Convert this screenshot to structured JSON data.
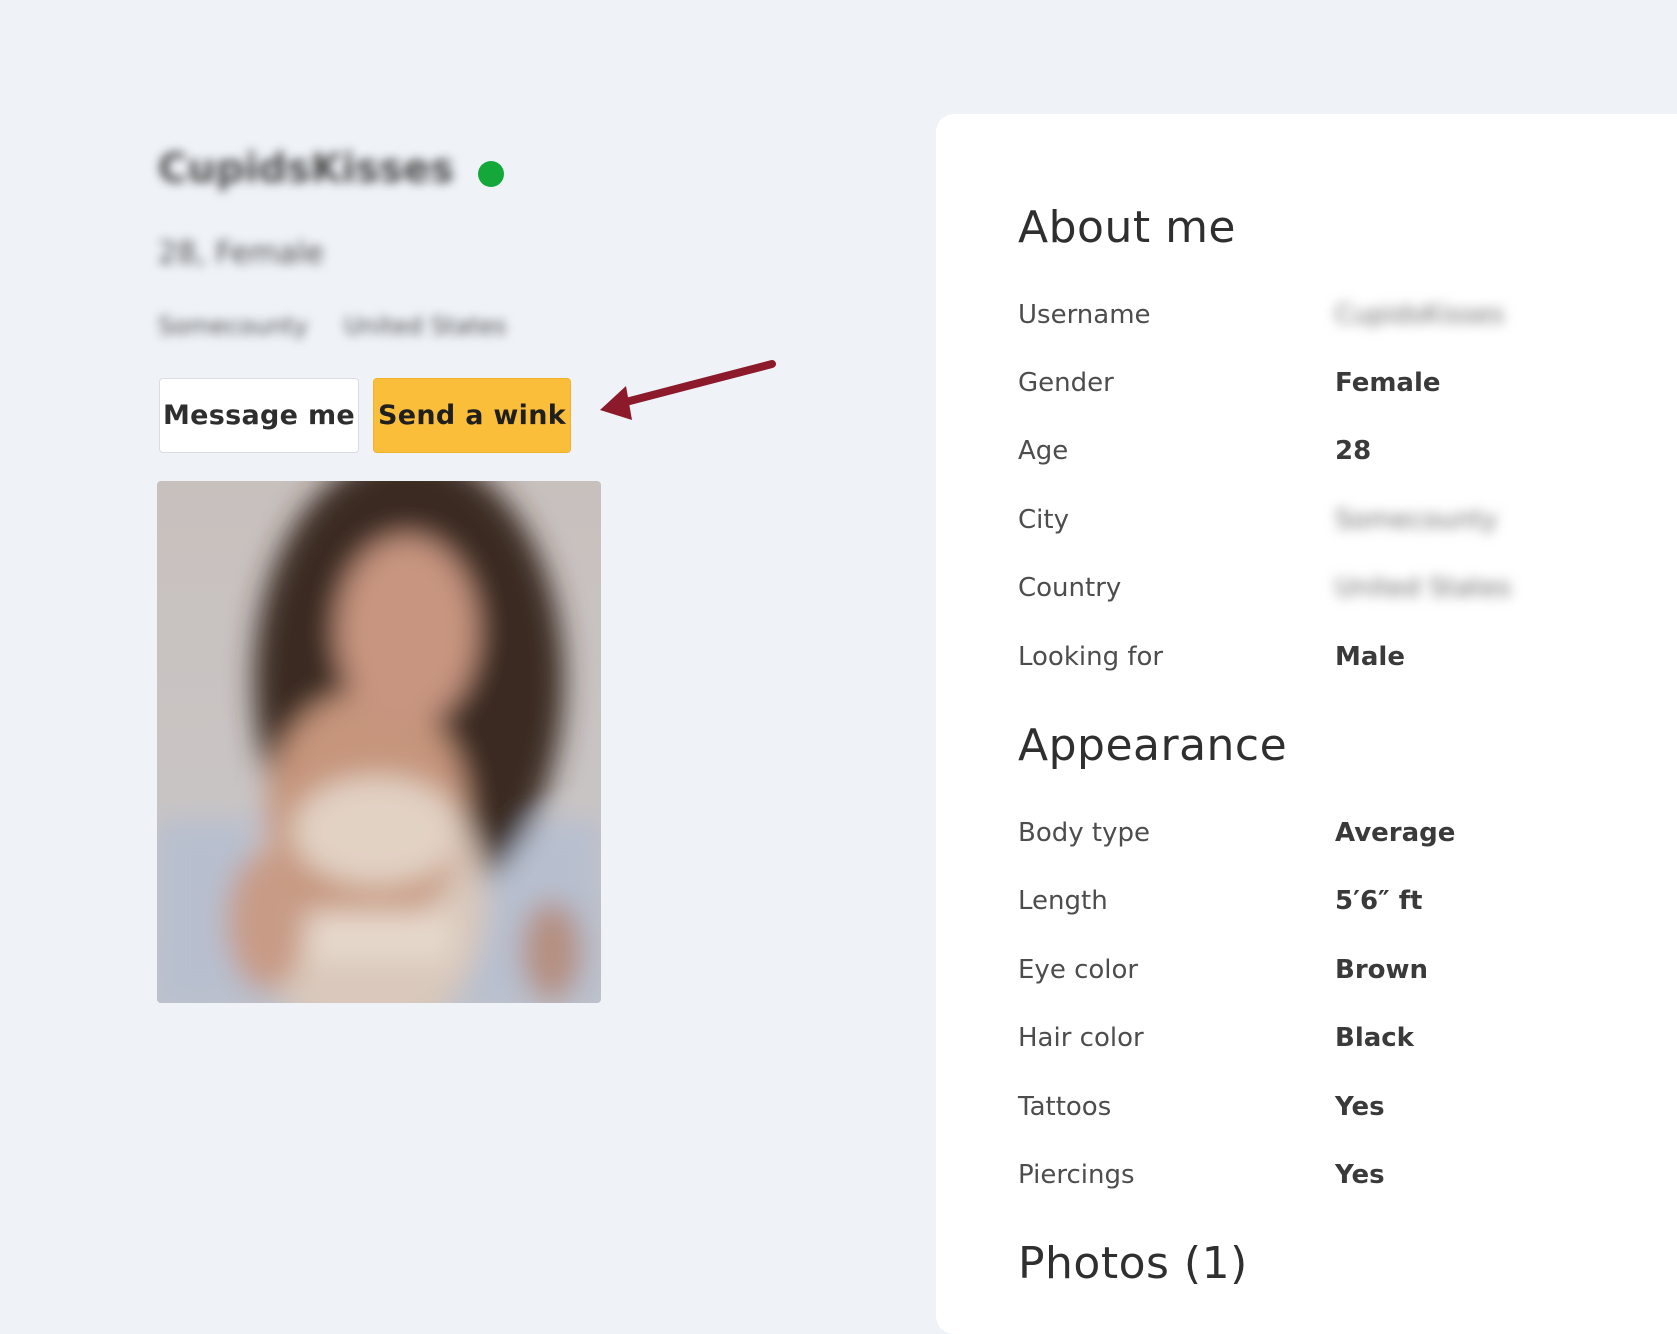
{
  "profile": {
    "username": "CupidsKisses",
    "age_gender": "28, Female",
    "city": "Somecounty",
    "country": "United States",
    "online_status_color": "#14a83b"
  },
  "actions": {
    "message_label": "Message me",
    "wink_label": "Send a wink",
    "wink_color": "#fbbe3b"
  },
  "annotation": {
    "arrow_color": "#8d1a2a",
    "icon": "arrow-left-icon"
  },
  "photo": {
    "icon": "profile-photo"
  },
  "about": {
    "heading": "About me",
    "rows": [
      {
        "label": "Username",
        "value": "CupidsKisses"
      },
      {
        "label": "Gender",
        "value": "Female"
      },
      {
        "label": "Age",
        "value": "28"
      },
      {
        "label": "City",
        "value": "Somecounty"
      },
      {
        "label": "Country",
        "value": "United States"
      },
      {
        "label": "Looking for",
        "value": "Male"
      }
    ]
  },
  "appearance": {
    "heading": "Appearance",
    "rows": [
      {
        "label": "Body type",
        "value": "Average"
      },
      {
        "label": "Length",
        "value": "5′6″ ft"
      },
      {
        "label": "Eye color",
        "value": "Brown"
      },
      {
        "label": "Hair color",
        "value": "Black"
      },
      {
        "label": "Tattoos",
        "value": "Yes"
      },
      {
        "label": "Piercings",
        "value": "Yes"
      }
    ]
  },
  "photos": {
    "heading": "Photos (1)"
  }
}
